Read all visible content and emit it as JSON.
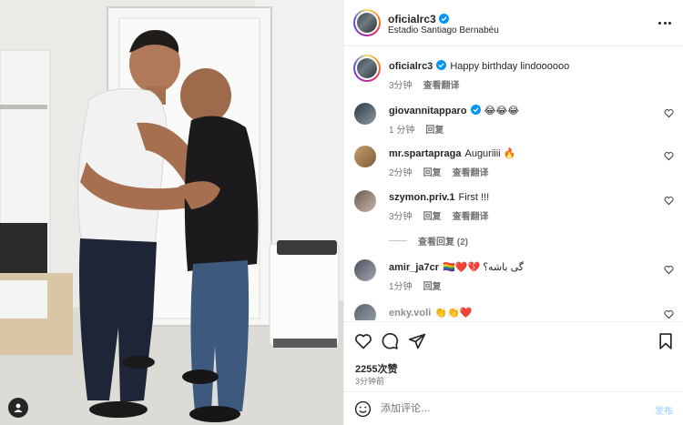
{
  "photo": {
    "alt_icon": "user-tag-icon"
  },
  "post": {
    "author": "oficialrc3",
    "verified": true,
    "location": "Estadio Santiago Bernabéu",
    "caption": "Happy birthday lindoooooo",
    "caption_time": "3分钟",
    "see_translation": "查看翻译",
    "more_icon": "more-horizontal-icon"
  },
  "comments": [
    {
      "username": "giovannitapparo",
      "verified": true,
      "text": "😂😂😂",
      "time": "1 分钟",
      "reply": "回复",
      "translate": "",
      "avatar_colors": [
        "#2f3b45",
        "#8a9aa6"
      ]
    },
    {
      "username": "mr.spartapraga",
      "verified": false,
      "text": "Auguriiii 🔥",
      "time": "2分钟",
      "reply": "回复",
      "translate": "查看翻译",
      "avatar_colors": [
        "#c9a06b",
        "#7d5a3a"
      ]
    },
    {
      "username": "szymon.priv.1",
      "verified": false,
      "text": "First !!!",
      "time": "3分钟",
      "reply": "回复",
      "translate": "查看翻译",
      "avatar_colors": [
        "#6b5a4e",
        "#c7b8aa"
      ]
    },
    {
      "username": "amir_ja7cr",
      "verified": false,
      "text": "🏳️‍🌈❤️💔 گی باشه؟",
      "time": "1分钟",
      "reply": "回复",
      "translate": "",
      "avatar_colors": [
        "#4a4f59",
        "#a4a9b3"
      ]
    },
    {
      "username": "enky.voli",
      "verified": false,
      "text": "👏👏❤️",
      "time": "",
      "reply": "",
      "translate": "",
      "avatar_colors": [
        "#596169",
        "#9aa3ab"
      ]
    }
  ],
  "view_replies": "查看回复 (2)",
  "actions": {
    "like_icon": "heart-icon",
    "comment_icon": "comment-icon",
    "share_icon": "send-icon",
    "save_icon": "bookmark-icon",
    "likes": "2255次赞",
    "posted": "3分钟前"
  },
  "composer": {
    "emoji_icon": "emoji-icon",
    "placeholder": "添加评论…",
    "post_label": "发布"
  },
  "colors": {
    "verified_blue": "#0095f6",
    "muted": "#737373",
    "post_disabled": "#b3dbff"
  }
}
